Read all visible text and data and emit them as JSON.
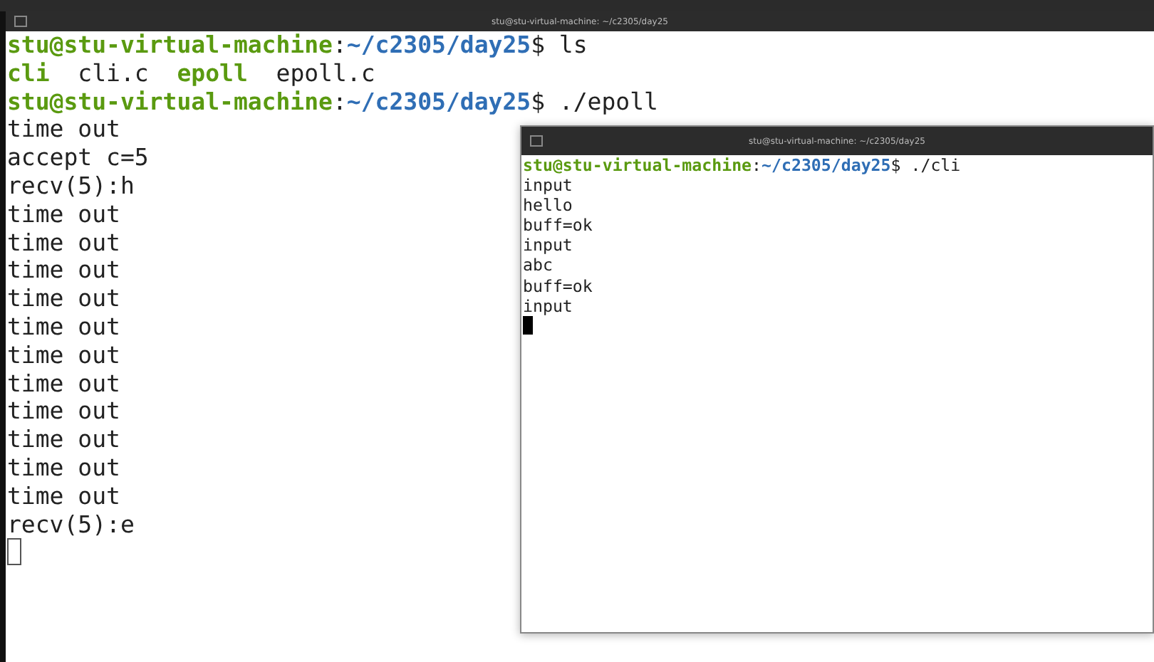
{
  "main_terminal": {
    "title": "stu@stu-virtual-machine: ~/c2305/day25",
    "focused": false,
    "lines": [
      [
        {
          "text": "stu@stu-virtual-machine",
          "kind": "user"
        },
        {
          "text": ":",
          "kind": "plain"
        },
        {
          "text": "~/c2305/day25",
          "kind": "path"
        },
        {
          "text": "$ ls",
          "kind": "plain"
        }
      ],
      [
        {
          "text": "cli",
          "kind": "exec"
        },
        {
          "text": "  cli.c  ",
          "kind": "plain"
        },
        {
          "text": "epoll",
          "kind": "exec"
        },
        {
          "text": "  epoll.c",
          "kind": "plain"
        }
      ],
      [
        {
          "text": "stu@stu-virtual-machine",
          "kind": "user"
        },
        {
          "text": ":",
          "kind": "plain"
        },
        {
          "text": "~/c2305/day25",
          "kind": "path"
        },
        {
          "text": "$ ./epoll",
          "kind": "plain"
        }
      ],
      [
        {
          "text": "time out",
          "kind": "plain"
        }
      ],
      [
        {
          "text": "accept c=5",
          "kind": "plain"
        }
      ],
      [
        {
          "text": "recv(5):h",
          "kind": "plain"
        }
      ],
      [
        {
          "text": "time out",
          "kind": "plain"
        }
      ],
      [
        {
          "text": "time out",
          "kind": "plain"
        }
      ],
      [
        {
          "text": "time out",
          "kind": "plain"
        }
      ],
      [
        {
          "text": "time out",
          "kind": "plain"
        }
      ],
      [
        {
          "text": "time out",
          "kind": "plain"
        }
      ],
      [
        {
          "text": "time out",
          "kind": "plain"
        }
      ],
      [
        {
          "text": "time out",
          "kind": "plain"
        }
      ],
      [
        {
          "text": "time out",
          "kind": "plain"
        }
      ],
      [
        {
          "text": "time out",
          "kind": "plain"
        }
      ],
      [
        {
          "text": "time out",
          "kind": "plain"
        }
      ],
      [
        {
          "text": "time out",
          "kind": "plain"
        }
      ],
      [
        {
          "text": "recv(5):e",
          "kind": "plain"
        }
      ]
    ]
  },
  "client_terminal": {
    "title": "stu@stu-virtual-machine: ~/c2305/day25",
    "focused": true,
    "lines": [
      [
        {
          "text": "stu@stu-virtual-machine",
          "kind": "user"
        },
        {
          "text": ":",
          "kind": "plain"
        },
        {
          "text": "~/c2305/day25",
          "kind": "path"
        },
        {
          "text": "$ ./cli",
          "kind": "plain"
        }
      ],
      [
        {
          "text": "input",
          "kind": "plain"
        }
      ],
      [
        {
          "text": "hello",
          "kind": "plain"
        }
      ],
      [
        {
          "text": "buff=ok",
          "kind": "plain"
        }
      ],
      [
        {
          "text": "input",
          "kind": "plain"
        }
      ],
      [
        {
          "text": "abc",
          "kind": "plain"
        }
      ],
      [
        {
          "text": "buff=ok",
          "kind": "plain"
        }
      ],
      [
        {
          "text": "input",
          "kind": "plain"
        }
      ]
    ]
  }
}
